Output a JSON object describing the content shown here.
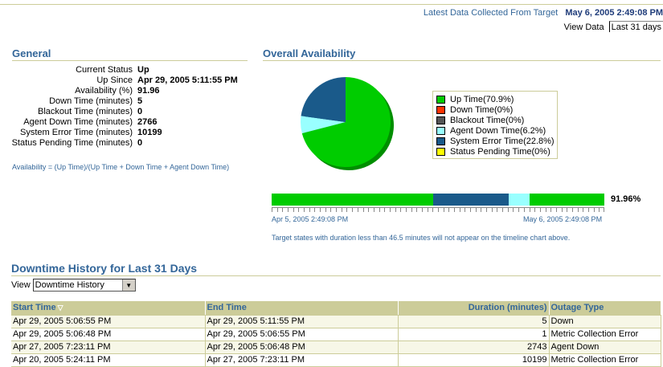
{
  "header": {
    "last_collected_label": "Latest Data Collected From Target",
    "last_collected_value": "May 6, 2005 2:49:08 PM",
    "view_data_label": "View Data",
    "view_data_value": "Last 31 days"
  },
  "general": {
    "title": "General",
    "rows": [
      {
        "label": "Current Status",
        "value": "Up"
      },
      {
        "label": "Up Since",
        "value": "Apr 29, 2005 5:11:55 PM"
      },
      {
        "label": "Availability (%)",
        "value": "91.96"
      },
      {
        "label": "Down Time (minutes)",
        "value": "5"
      },
      {
        "label": "Blackout Time (minutes)",
        "value": "0"
      },
      {
        "label": "Agent Down Time (minutes)",
        "value": "2766"
      },
      {
        "label": "System Error Time (minutes)",
        "value": "10199"
      },
      {
        "label": "Status Pending Time (minutes)",
        "value": "0"
      }
    ],
    "formula": "Availability = (Up Time)/(Up Time + Down Time + Agent Down Time)"
  },
  "availability": {
    "title": "Overall Availability",
    "legend": [
      {
        "label": "Up Time(70.9%)",
        "color": "#00cc00"
      },
      {
        "label": "Down Time(0%)",
        "color": "#ff3300"
      },
      {
        "label": "Blackout Time(0%)",
        "color": "#555555"
      },
      {
        "label": "Agent Down Time(6.2%)",
        "color": "#99ffff"
      },
      {
        "label": "System Error Time(22.8%)",
        "color": "#1a5a8a"
      },
      {
        "label": "Status Pending Time(0%)",
        "color": "#ffff00"
      }
    ],
    "timeline_percent": "91.96%",
    "timeline_start": "Apr 5, 2005 2:49:08 PM",
    "timeline_end": "May 6, 2005 2:49:08 PM",
    "timeline_note": "Target states with duration less than 46.5 minutes will not appear on the timeline chart above."
  },
  "chart_data": {
    "type": "pie",
    "slices": [
      {
        "name": "Up Time",
        "value": 70.9,
        "color": "#00cc00"
      },
      {
        "name": "Down Time",
        "value": 0,
        "color": "#ff3300"
      },
      {
        "name": "Blackout Time",
        "value": 0,
        "color": "#555555"
      },
      {
        "name": "Agent Down Time",
        "value": 6.2,
        "color": "#99ffff"
      },
      {
        "name": "System Error Time",
        "value": 22.8,
        "color": "#1a5a8a"
      },
      {
        "name": "Status Pending Time",
        "value": 0,
        "color": "#ffff00"
      }
    ],
    "timeline": [
      {
        "state": "Up",
        "fraction": 0.485,
        "color": "#00cc00"
      },
      {
        "state": "System Error",
        "fraction": 0.228,
        "color": "#1a5a8a"
      },
      {
        "state": "Agent Down",
        "fraction": 0.062,
        "color": "#99ffff"
      },
      {
        "state": "Up",
        "fraction": 0.225,
        "color": "#00cc00"
      }
    ]
  },
  "downtime": {
    "title": "Downtime History for Last 31 Days",
    "view_label": "View",
    "view_value": "Downtime History",
    "columns": [
      "Start Time",
      "End Time",
      "Duration (minutes)",
      "Outage Type"
    ],
    "rows": [
      [
        "Apr 29, 2005 5:06:55 PM",
        "Apr 29, 2005 5:11:55 PM",
        "5",
        "Down"
      ],
      [
        "Apr 29, 2005 5:06:48 PM",
        "Apr 29, 2005 5:06:55 PM",
        "1",
        "Metric Collection Error"
      ],
      [
        "Apr 27, 2005 7:23:11 PM",
        "Apr 29, 2005 5:06:48 PM",
        "2743",
        "Agent Down"
      ],
      [
        "Apr 20, 2005 5:24:11 PM",
        "Apr 27, 2005 7:23:11 PM",
        "10199",
        "Metric Collection Error"
      ]
    ]
  }
}
